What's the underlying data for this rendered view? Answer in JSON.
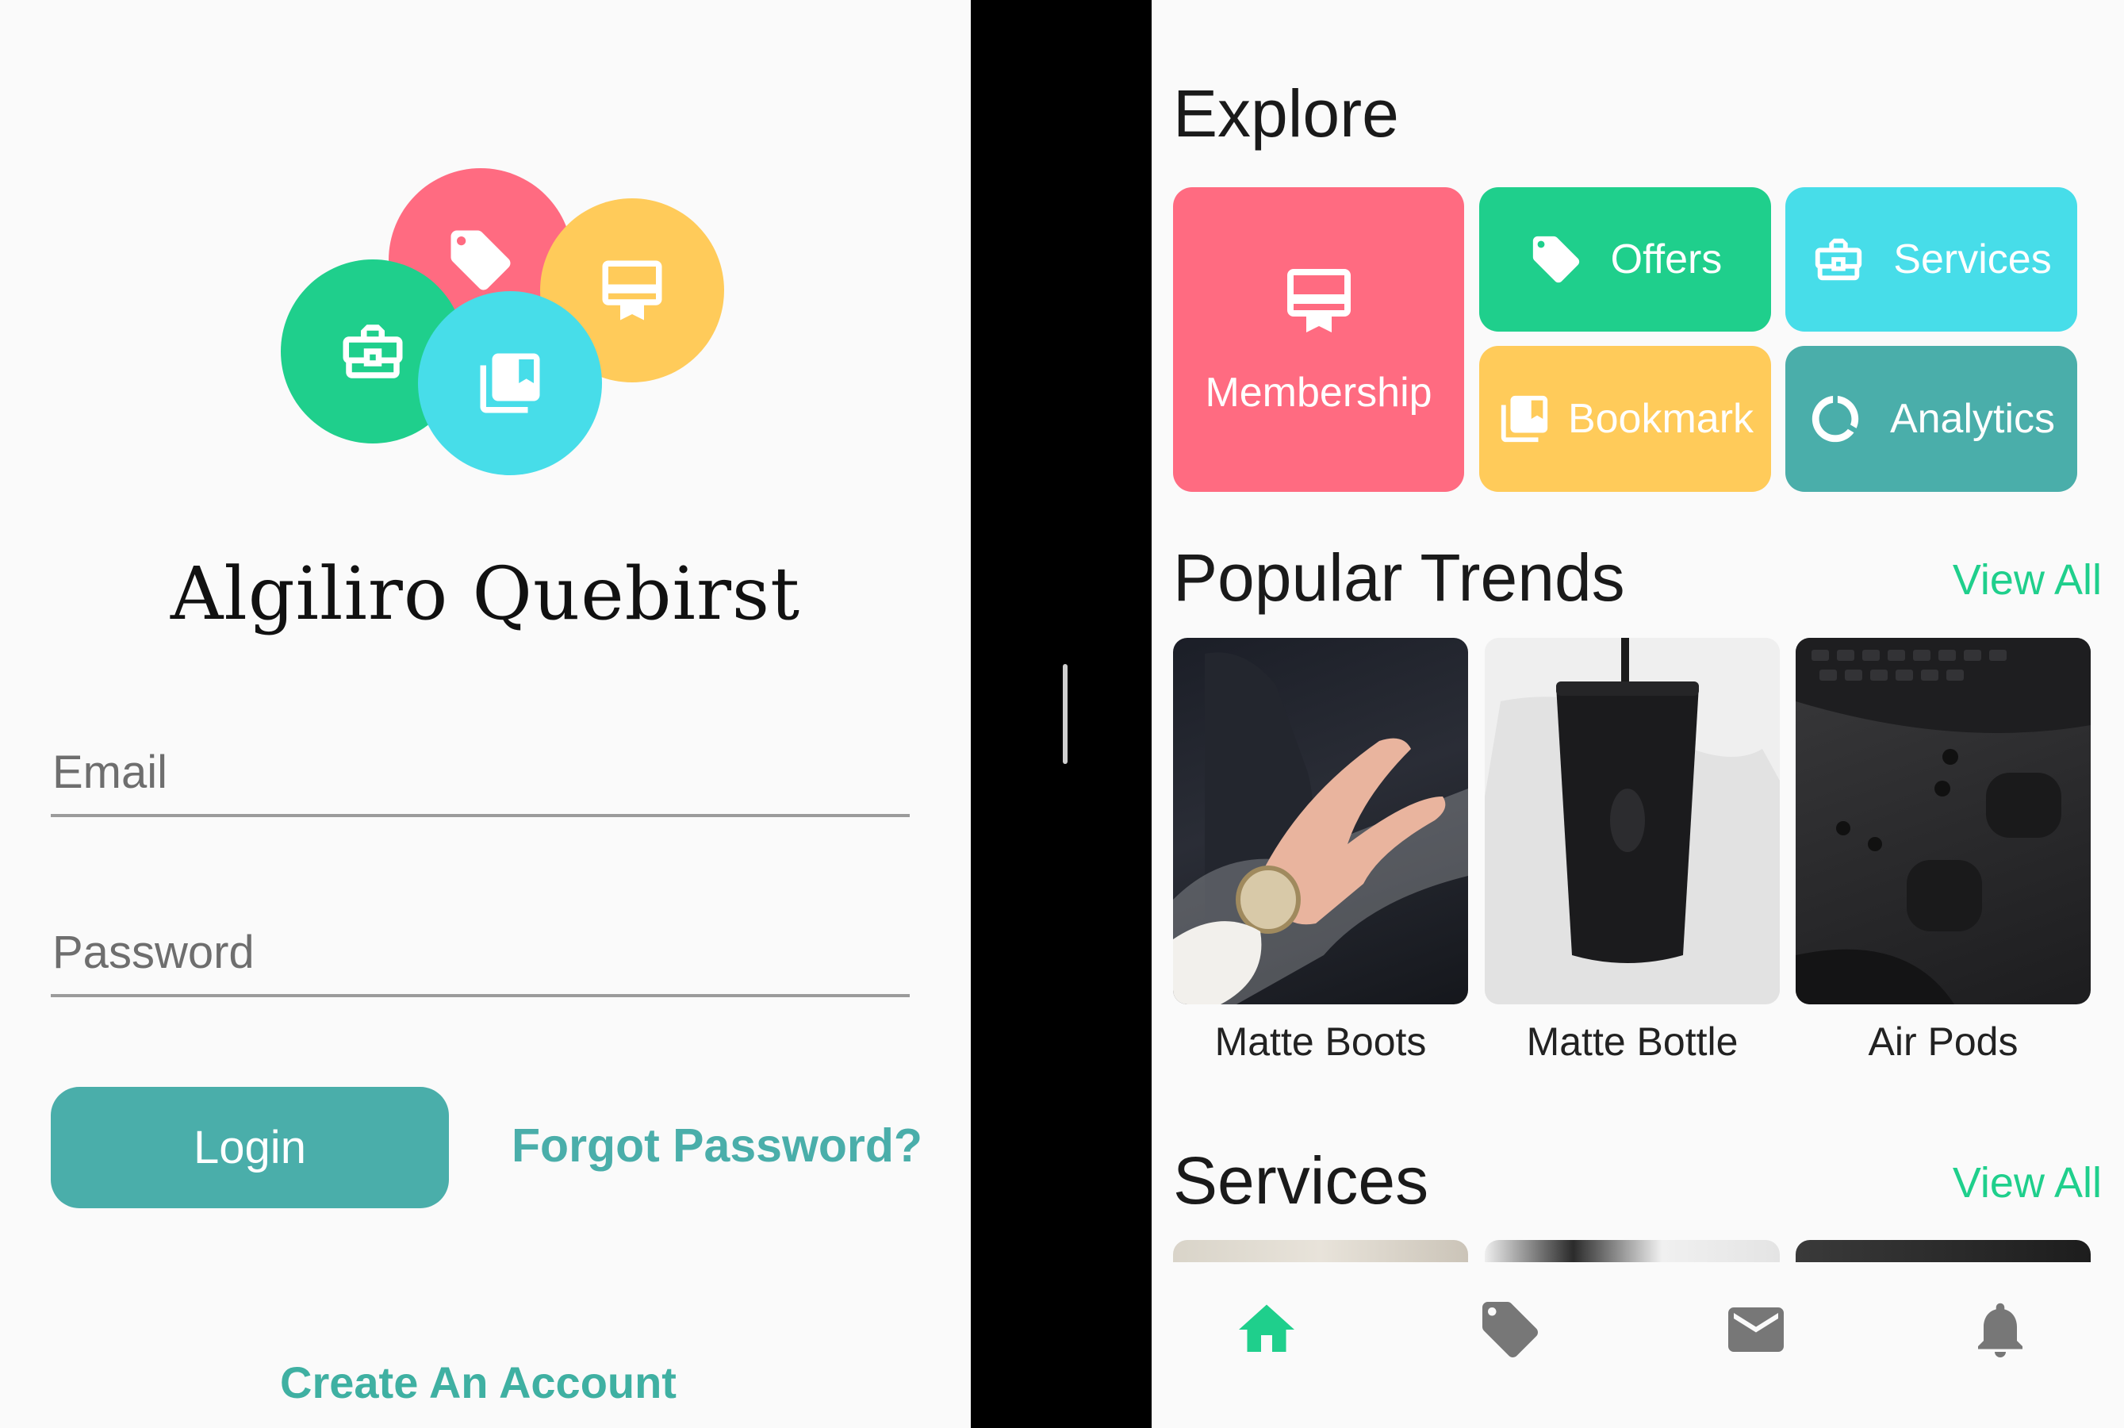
{
  "login": {
    "app_name": "Algiliro Quebirst",
    "email_placeholder": "Email",
    "password_placeholder": "Password",
    "login_label": "Login",
    "forgot_label": "Forgot Password?",
    "create_account_label": "Create An Account",
    "logo_icons": [
      "tag-icon",
      "card-membership-icon",
      "briefcase-icon",
      "bookmark-library-icon"
    ]
  },
  "explore": {
    "title": "Explore",
    "tiles": [
      {
        "label": "Membership",
        "icon": "card-membership-icon",
        "color": "#ff6b81"
      },
      {
        "label": "Offers",
        "icon": "tag-icon",
        "color": "#1fcf8c"
      },
      {
        "label": "Services",
        "icon": "briefcase-icon",
        "color": "#47dde9"
      },
      {
        "label": "Bookmark",
        "icon": "bookmark-library-icon",
        "color": "#ffcb5a"
      },
      {
        "label": "Analytics",
        "icon": "donut-chart-icon",
        "color": "#4aaeaa"
      }
    ]
  },
  "trends": {
    "title": "Popular Trends",
    "view_all": "View All",
    "items": [
      {
        "label": "Matte Boots"
      },
      {
        "label": "Matte Bottle"
      },
      {
        "label": "Air Pods"
      }
    ]
  },
  "services": {
    "title": "Services",
    "view_all": "View All"
  },
  "bottom_nav": {
    "items": [
      {
        "icon": "home-icon",
        "active": true
      },
      {
        "icon": "tag-icon",
        "active": false
      },
      {
        "icon": "mail-icon",
        "active": false
      },
      {
        "icon": "bell-icon",
        "active": false
      }
    ]
  },
  "colors": {
    "accent_teal": "#4aaeaa",
    "accent_green": "#1fcf8c",
    "pink": "#ff6b81",
    "yellow": "#ffcb5a",
    "cyan": "#47dde9"
  }
}
